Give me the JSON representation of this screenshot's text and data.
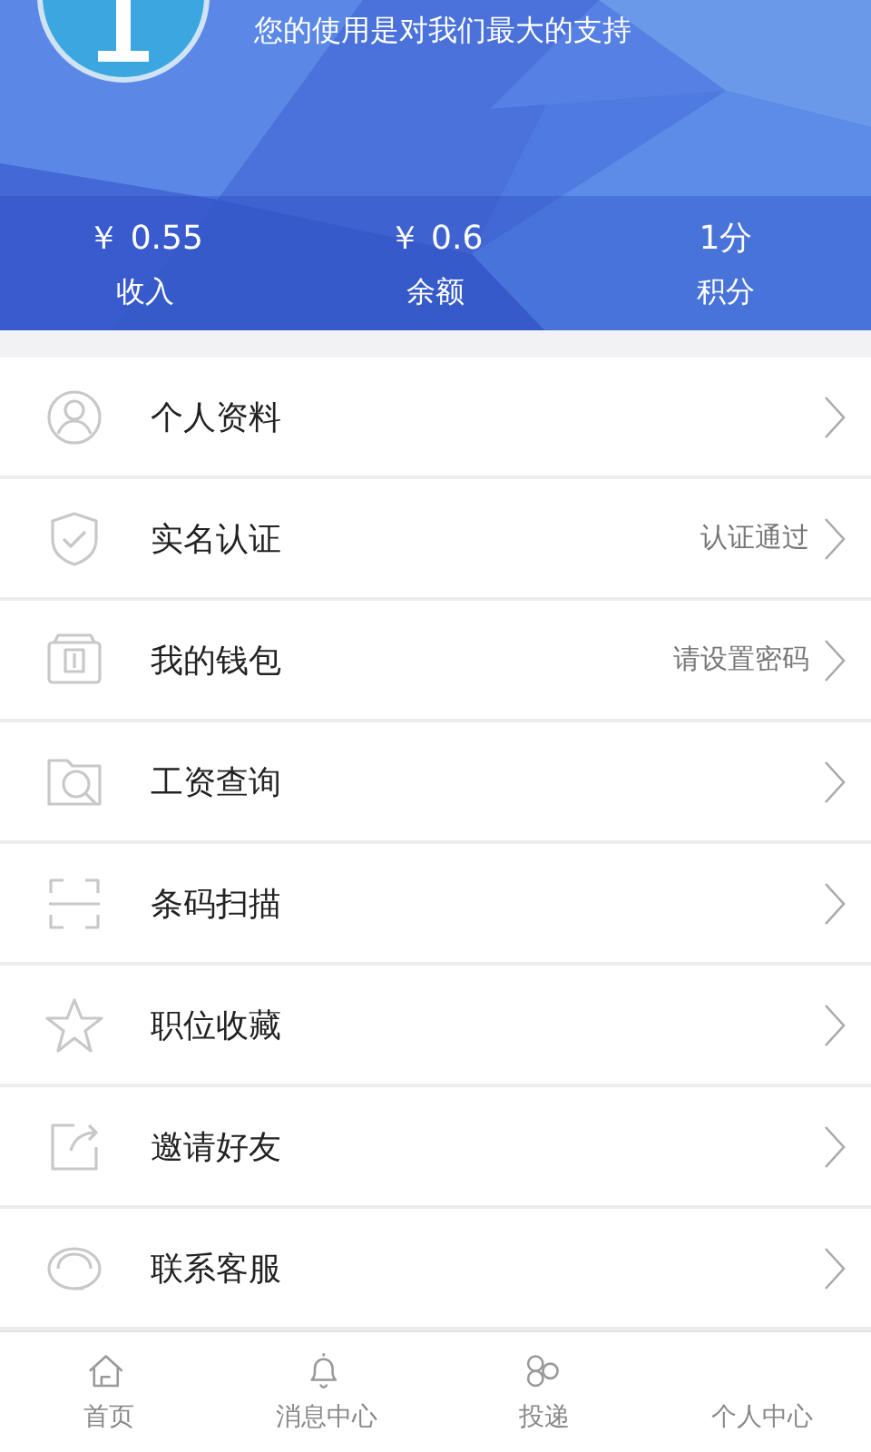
{
  "header": {
    "subtitle": "您的使用是对我们最大的支持"
  },
  "stats": [
    {
      "value": "￥ 0.55",
      "label": "收入"
    },
    {
      "value": "￥ 0.6",
      "label": "余额"
    },
    {
      "value": "1分",
      "label": "积分"
    }
  ],
  "menu": [
    {
      "label": "个人资料"
    },
    {
      "label": "实名认证",
      "status": "认证通过"
    },
    {
      "label": "我的钱包",
      "status": "请设置密码"
    },
    {
      "label": "工资查询"
    },
    {
      "label": "条码扫描"
    },
    {
      "label": "职位收藏"
    },
    {
      "label": "邀请好友"
    },
    {
      "label": "联系客服"
    }
  ],
  "tabs": [
    {
      "label": "首页"
    },
    {
      "label": "消息中心"
    },
    {
      "label": "投递"
    },
    {
      "label": "个人中心"
    }
  ]
}
